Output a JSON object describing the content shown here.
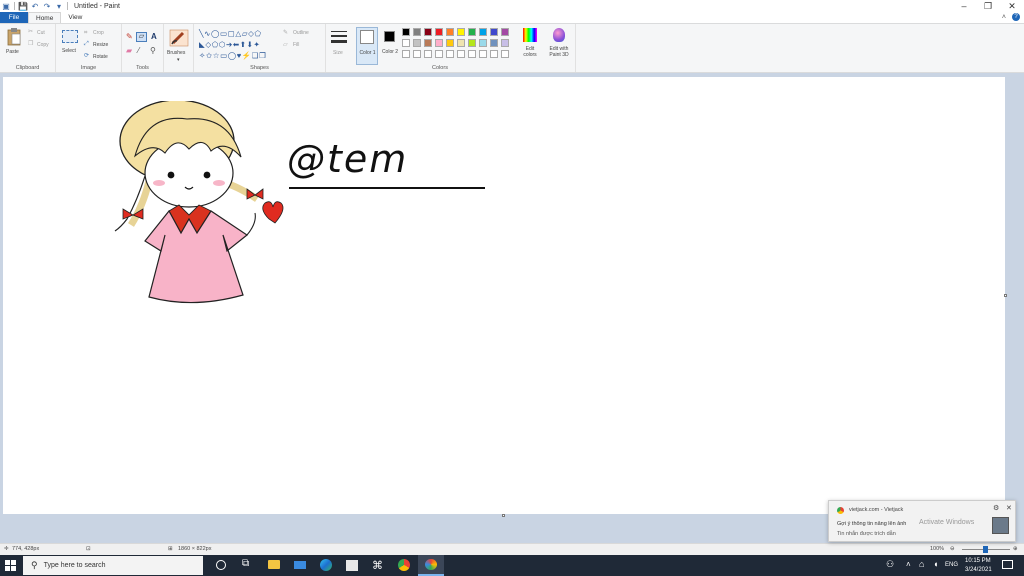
{
  "window": {
    "title": "Untitled - Paint"
  },
  "tabs": [
    {
      "label": "File"
    },
    {
      "label": "Home"
    },
    {
      "label": "View"
    }
  ],
  "ribbon": {
    "clipboard": {
      "label": "Clipboard",
      "paste": "Paste",
      "cut": "Cut",
      "copy": "Copy"
    },
    "image": {
      "label": "Image",
      "select": "Select",
      "crop": "Crop",
      "resize": "Resize",
      "rotate": "Rotate"
    },
    "tools": {
      "label": "Tools"
    },
    "brushes": {
      "label": "Brushes"
    },
    "shapes": {
      "label": "Shapes",
      "outline": "Outline",
      "fill": "Fill"
    },
    "size": {
      "label": "Size"
    },
    "color1": {
      "label": "Color 1"
    },
    "color2": {
      "label": "Color 2"
    },
    "colors": {
      "label": "Colors",
      "edit": "Edit colors",
      "paint3d": "Edit with Paint 3D",
      "row1": [
        "#000000",
        "#7f7f7f",
        "#880015",
        "#ed1c24",
        "#ff7f27",
        "#fff200",
        "#22b14c",
        "#00a2e8",
        "#3f48cc",
        "#a349a4"
      ],
      "row2": [
        "#ffffff",
        "#c3c3c3",
        "#b97a57",
        "#ffaec9",
        "#ffc90e",
        "#efe4b0",
        "#b5e61d",
        "#99d9ea",
        "#7092be",
        "#c8bfe7"
      ]
    }
  },
  "drawing": {
    "text": "@tem"
  },
  "status": {
    "cursor": "774, 428px",
    "canvas_size": "1860 × 822px",
    "zoom": "100%"
  },
  "taskbar": {
    "search_placeholder": "Type here to search",
    "language": "ENG",
    "time": "10:15 PM",
    "date": "3/24/2021"
  },
  "notification": {
    "source": "vietjack.com - Vietjack",
    "watermark": "Activate Windows",
    "line1": "Gợi ý thông tin nâng lên ảnh",
    "line2": "Tin nhắn được trích dẫn"
  }
}
